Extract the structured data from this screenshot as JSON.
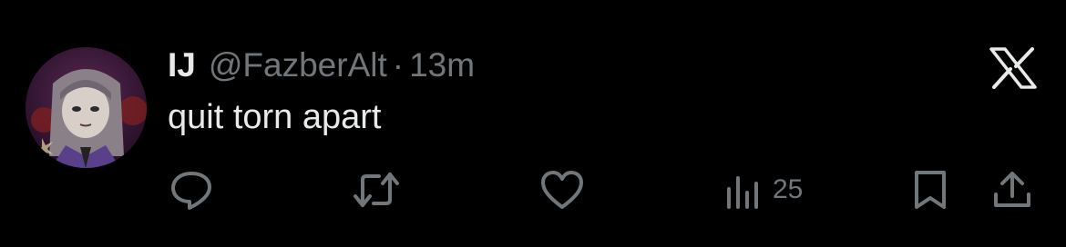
{
  "tweet": {
    "display_name": "IJ",
    "handle": "@FazberAlt",
    "separator": "·",
    "time": "13m",
    "text": "quit torn apart"
  },
  "actions": {
    "views_count": "25"
  },
  "icons": {
    "brand": "x-logo-icon",
    "reply": "reply-icon",
    "retweet": "retweet-icon",
    "like": "heart-icon",
    "views": "views-chart-icon",
    "bookmark": "bookmark-icon",
    "share": "share-icon"
  },
  "colors": {
    "background": "#000000",
    "primary_text": "#e7e9ea",
    "secondary_text": "#71767b"
  }
}
